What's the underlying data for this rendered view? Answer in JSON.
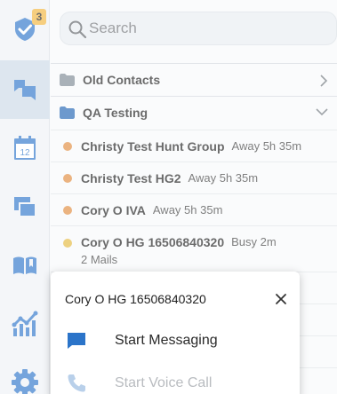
{
  "sidebar": {
    "notifications_badge": "3",
    "items": [
      {
        "name": "tasks",
        "icon": "shield-check-icon"
      },
      {
        "name": "messages",
        "icon": "chat-icon",
        "active": true
      },
      {
        "name": "calendar",
        "icon": "calendar-icon",
        "day": "12"
      },
      {
        "name": "screens",
        "icon": "windows-icon"
      },
      {
        "name": "library",
        "icon": "book-icon"
      },
      {
        "name": "analytics",
        "icon": "chart-icon"
      },
      {
        "name": "settings",
        "icon": "gear-icon"
      }
    ]
  },
  "search": {
    "placeholder": "Search"
  },
  "groups": [
    {
      "label": "Old Contacts",
      "expanded": false
    },
    {
      "label": "QA Testing",
      "expanded": true
    }
  ],
  "contacts": [
    {
      "name": "Christy Test Hunt Group",
      "status": "Away 5h 35m",
      "color": "#e08a3c"
    },
    {
      "name": "Christy Test HG2",
      "status": "Away 5h 35m",
      "color": "#e08a3c"
    },
    {
      "name": "Cory O IVA",
      "status": "Away 5h 35m",
      "color": "#e08a3c"
    },
    {
      "name": "Cory O HG 16506840320",
      "status": "Busy 2m",
      "sub": "2 Mails",
      "color": "#e4b83d"
    }
  ],
  "popup": {
    "title": "Cory O HG 16506840320",
    "actions": [
      {
        "label": "Start Messaging",
        "enabled": true
      },
      {
        "label": "Start Voice Call",
        "enabled": false
      }
    ]
  },
  "colors": {
    "accent": "#2b74c9",
    "active_sidebar": "#cbd9e6"
  }
}
